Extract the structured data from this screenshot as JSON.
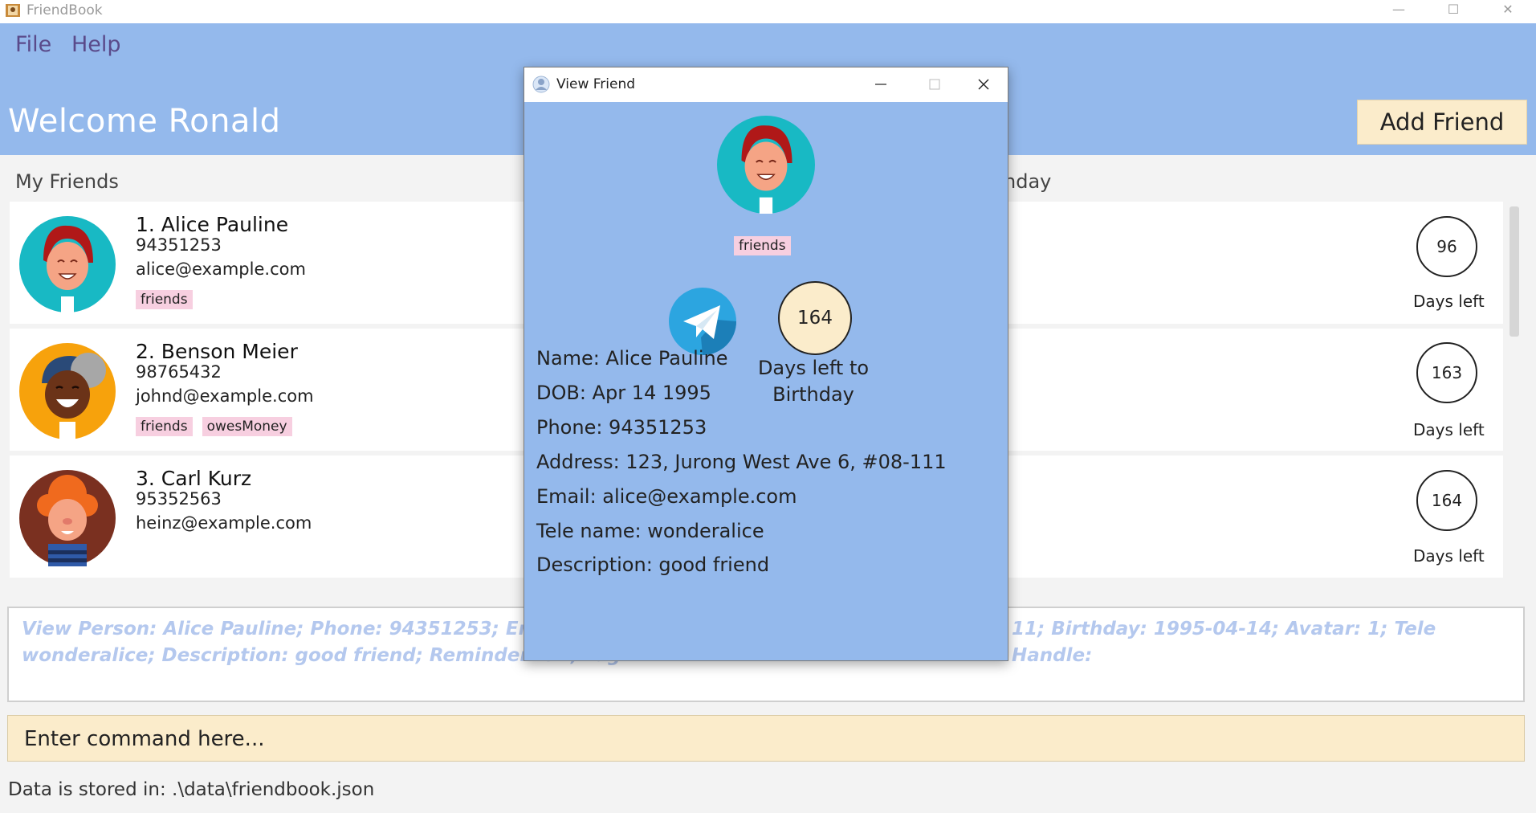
{
  "window": {
    "title": "FriendBook",
    "minimize_glyph": "—",
    "maximize_glyph": "☐",
    "close_glyph": "✕"
  },
  "menu": {
    "file": "File",
    "help": "Help"
  },
  "header": {
    "welcome": "Welcome  Ronald",
    "add_friend": "Add Friend"
  },
  "sections": {
    "my_friends": "My Friends",
    "birthday_partial": "nday"
  },
  "friends": [
    {
      "index_name": "1.  Alice Pauline",
      "phone": "94351253",
      "email": "alice@example.com",
      "tags": [
        "friends"
      ],
      "days": "96",
      "days_label": "Days left",
      "avatar_icon": "girl-red-hair-avatar-icon"
    },
    {
      "index_name": "2.  Benson Meier",
      "phone": "98765432",
      "email": "johnd@example.com",
      "tags": [
        "friends",
        "owesMoney"
      ],
      "days": "163",
      "days_label": "Days left",
      "avatar_icon": "boy-cap-avatar-icon"
    },
    {
      "index_name": "3.  Carl Kurz",
      "phone": "95352563",
      "email": "heinz@example.com",
      "tags": [],
      "days": "164",
      "days_label": "Days left",
      "avatar_icon": "boy-orange-hair-avatar-icon"
    }
  ],
  "result": {
    "left_line1": "View Person: Alice Pauline; Phone: 94351253; Email: alice",
    "left_line2": "wonderalice; Description: good friend; Reminder: off; Tag",
    "right_line1": "11; Birthday: 1995-04-14; Avatar: 1; Tele Handle:"
  },
  "command": {
    "placeholder": "Enter command here..."
  },
  "status": {
    "text": "Data is stored in: .\\data\\friendbook.json"
  },
  "dialog": {
    "title": "View Friend",
    "tag": "friends",
    "days": "164",
    "days_label_line1": "Days left to",
    "days_label_line2": "Birthday",
    "fields": {
      "name": "Name: Alice Pauline",
      "dob": "DOB: Apr 14 1995",
      "phone": "Phone: 94351253",
      "address": "Address: 123, Jurong West Ave 6, #08-111",
      "email": "Email: alice@example.com",
      "tele": "Tele name: wonderalice",
      "description": "Description: good friend"
    }
  },
  "colors": {
    "header_bg": "#94b9ec",
    "accent_button": "#fbeccb",
    "tag_bg": "#f7cfe0",
    "result_text": "#b4c8ee",
    "telegram_blue": "#2ca5e0"
  }
}
